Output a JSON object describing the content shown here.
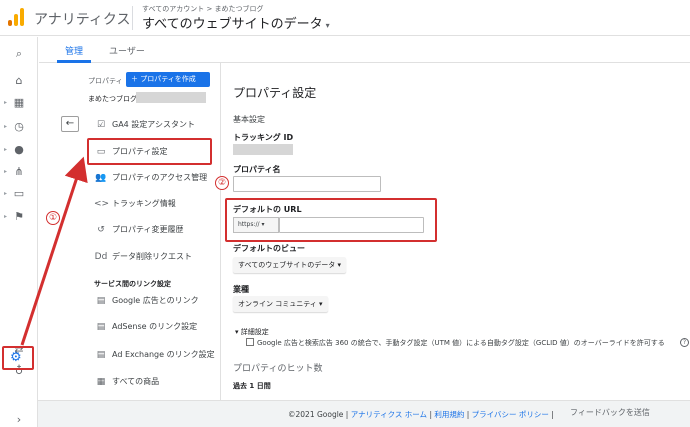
{
  "header": {
    "app_name": "アナリティクス",
    "breadcrumb": "すべてのアカウント > まめたつブログ",
    "view_title": "すべてのウェブサイトのデータ",
    "caret": "▾"
  },
  "rail": {
    "icons": [
      "search-icon",
      "home-icon",
      "dashboard-icon",
      "realtime-icon",
      "audience-icon",
      "acquisition-icon",
      "behavior-icon",
      "conversions-icon",
      "attribution-icon",
      "discover-icon",
      "gear-icon",
      "expand-icon"
    ]
  },
  "tabs": [
    {
      "label": "管理",
      "active": true
    },
    {
      "label": "ユーザー",
      "active": false
    }
  ],
  "property_column": {
    "label": "プロパティ",
    "create_button": "＋ プロパティを作成",
    "property_name": "まめたつブログ",
    "back_icon": "←",
    "items": [
      {
        "label": "GA4 設定アシスタント",
        "icon": "☑"
      },
      {
        "label": "プロパティ設定",
        "icon": "▭"
      },
      {
        "label": "プロパティのアクセス管理",
        "icon": "👥"
      },
      {
        "label": "トラッキング情報",
        "icon": "<>"
      },
      {
        "label": "プロパティ変更履歴",
        "icon": "↺"
      },
      {
        "label": "データ削除リクエスト",
        "icon": "Dd"
      }
    ],
    "section_label": "サービス間のリンク設定",
    "link_items": [
      {
        "label": "Google 広告とのリンク",
        "icon": "▤"
      },
      {
        "label": "AdSense のリンク設定",
        "icon": "▤"
      },
      {
        "label": "Ad Exchange のリンク設定",
        "icon": "▤"
      },
      {
        "label": "すべての商品",
        "icon": "▦"
      }
    ]
  },
  "settings": {
    "title": "プロパティ設定",
    "basic": "基本設定",
    "tracking_id_label": "トラッキング ID",
    "property_name_label": "プロパティ名",
    "default_url_label": "デフォルトの URL",
    "url_protocol": "https://",
    "url_caret": "▾",
    "default_view_label": "デフォルトのビュー",
    "default_view_value": "すべてのウェブサイトのデータ ▾",
    "industry_label": "業種",
    "industry_value": "オンライン コミュニティ ▾",
    "advanced_label": "▾ 詳細設定",
    "checkbox_text": "Google 広告と検索広告 360 の統合で、手動タグ設定（UTM 値）による自動タグ設定（GCLID 値）のオーバーライドを許可する",
    "help": "?",
    "hits_heading": "プロパティのヒット数",
    "hits_sub": "過去 1 日間"
  },
  "footer": {
    "copyright": "©2021 Google | ",
    "home_link": "アナリティクス ホーム",
    "sep1": " | ",
    "terms_link": "利用規約",
    "sep2": " | ",
    "privacy_link": "プライバシー ポリシー",
    "sep3": " | ",
    "feedback": "フィードバックを送信"
  },
  "annotations": {
    "marker_1": "①",
    "marker_2": "②"
  },
  "colors": {
    "accent": "#1a73e8",
    "annotation": "#d32f2f"
  }
}
